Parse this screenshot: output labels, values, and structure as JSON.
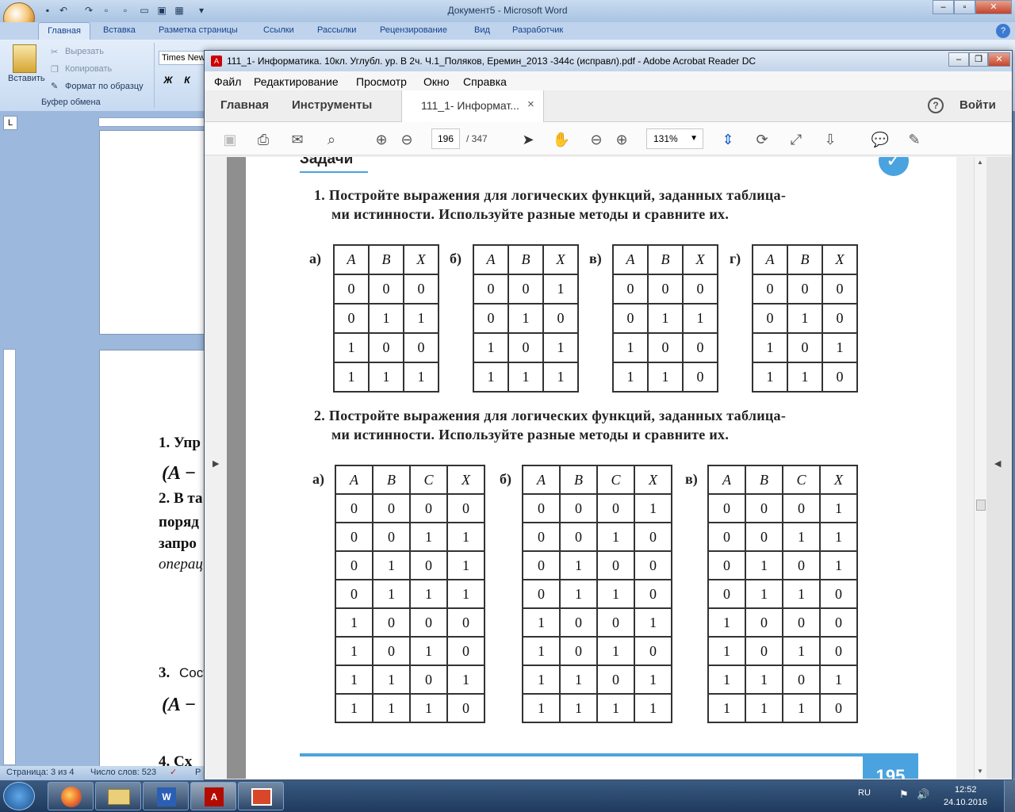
{
  "word": {
    "title": "Документ5 - Microsoft Word",
    "tabs": [
      "Главная",
      "Вставка",
      "Разметка страницы",
      "Ссылки",
      "Рассылки",
      "Рецензирование",
      "Вид",
      "Разработчик"
    ],
    "clipboard": {
      "paste": "Вставить",
      "cut": "Вырезать",
      "copy": "Копировать",
      "format_painter": "Формат по образцу",
      "group": "Буфер обмена"
    },
    "font_name": "Times New",
    "bold": "Ж",
    "italic": "К",
    "doc_lines": {
      "l1": "1. Упр",
      "l2": "(A −",
      "l3": "2. В та",
      "l4": "поряд",
      "l5": "запро",
      "l6": "операц",
      "l7": "3.",
      "l7b": "Сост",
      "l8": "(A −",
      "l9": "4. Сх"
    },
    "status": {
      "page": "Страница: 3 из 4",
      "words": "Число слов: 523",
      "r": "Р"
    }
  },
  "acrobat": {
    "title": "111_1- Информатика. 10кл. Углубл. ур. В 2ч. Ч.1_Поляков, Еремин_2013 -344с (исправл).pdf - Adobe Acrobat Reader DC",
    "menu": [
      "Файл",
      "Редактирование",
      "Просмотр",
      "Окно",
      "Справка"
    ],
    "tabs": {
      "home": "Главная",
      "tools": "Инструменты",
      "doc": "111_1- Информат...",
      "close": "×",
      "help": "?",
      "signin": "Войти"
    },
    "page_current": "196",
    "page_total": "/ 347",
    "zoom": "131%"
  },
  "pdf": {
    "heading": "Задачи",
    "task1_l1": "1. Постройте выражения для логических функций, заданных таблица-",
    "task1_l2": "ми истинности. Используйте разные методы и сравните их.",
    "task2_l1": "2. Постройте выражения для логических функций, заданных таблица-",
    "task2_l2": "ми истинности. Используйте разные методы и сравните их.",
    "page_no": "195",
    "tables1": [
      {
        "label": "а)",
        "head": [
          "A",
          "B",
          "X"
        ],
        "rows": [
          [
            "0",
            "0",
            "0"
          ],
          [
            "0",
            "1",
            "1"
          ],
          [
            "1",
            "0",
            "0"
          ],
          [
            "1",
            "1",
            "1"
          ]
        ]
      },
      {
        "label": "б)",
        "head": [
          "A",
          "B",
          "X"
        ],
        "rows": [
          [
            "0",
            "0",
            "1"
          ],
          [
            "0",
            "1",
            "0"
          ],
          [
            "1",
            "0",
            "1"
          ],
          [
            "1",
            "1",
            "1"
          ]
        ]
      },
      {
        "label": "в)",
        "head": [
          "A",
          "B",
          "X"
        ],
        "rows": [
          [
            "0",
            "0",
            "0"
          ],
          [
            "0",
            "1",
            "1"
          ],
          [
            "1",
            "0",
            "0"
          ],
          [
            "1",
            "1",
            "0"
          ]
        ]
      },
      {
        "label": "г)",
        "head": [
          "A",
          "B",
          "X"
        ],
        "rows": [
          [
            "0",
            "0",
            "0"
          ],
          [
            "0",
            "1",
            "0"
          ],
          [
            "1",
            "0",
            "1"
          ],
          [
            "1",
            "1",
            "0"
          ]
        ]
      }
    ],
    "tables2": [
      {
        "label": "а)",
        "head": [
          "A",
          "B",
          "C",
          "X"
        ],
        "rows": [
          [
            "0",
            "0",
            "0",
            "0"
          ],
          [
            "0",
            "0",
            "1",
            "1"
          ],
          [
            "0",
            "1",
            "0",
            "1"
          ],
          [
            "0",
            "1",
            "1",
            "1"
          ],
          [
            "1",
            "0",
            "0",
            "0"
          ],
          [
            "1",
            "0",
            "1",
            "0"
          ],
          [
            "1",
            "1",
            "0",
            "1"
          ],
          [
            "1",
            "1",
            "1",
            "0"
          ]
        ]
      },
      {
        "label": "б)",
        "head": [
          "A",
          "B",
          "C",
          "X"
        ],
        "rows": [
          [
            "0",
            "0",
            "0",
            "1"
          ],
          [
            "0",
            "0",
            "1",
            "0"
          ],
          [
            "0",
            "1",
            "0",
            "0"
          ],
          [
            "0",
            "1",
            "1",
            "0"
          ],
          [
            "1",
            "0",
            "0",
            "1"
          ],
          [
            "1",
            "0",
            "1",
            "0"
          ],
          [
            "1",
            "1",
            "0",
            "1"
          ],
          [
            "1",
            "1",
            "1",
            "1"
          ]
        ]
      },
      {
        "label": "в)",
        "head": [
          "A",
          "B",
          "C",
          "X"
        ],
        "rows": [
          [
            "0",
            "0",
            "0",
            "1"
          ],
          [
            "0",
            "0",
            "1",
            "1"
          ],
          [
            "0",
            "1",
            "0",
            "1"
          ],
          [
            "0",
            "1",
            "1",
            "0"
          ],
          [
            "1",
            "0",
            "0",
            "0"
          ],
          [
            "1",
            "0",
            "1",
            "0"
          ],
          [
            "1",
            "1",
            "0",
            "1"
          ],
          [
            "1",
            "1",
            "1",
            "0"
          ]
        ]
      }
    ]
  },
  "taskbar": {
    "lang": "RU",
    "time": "12:52",
    "date": "24.10.2016"
  }
}
